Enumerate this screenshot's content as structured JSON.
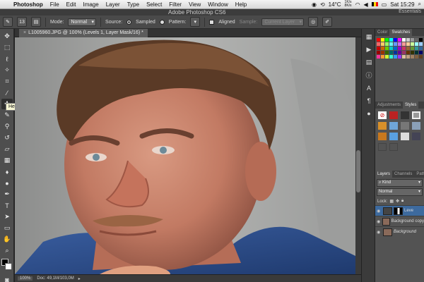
{
  "menubar": {
    "apple_icon": "apple-icon",
    "app": "Photoshop",
    "items": [
      "File",
      "Edit",
      "Image",
      "Layer",
      "Type",
      "Select",
      "Filter",
      "View",
      "Window",
      "Help"
    ],
    "temp": "14°C",
    "net_top": "1K/s",
    "net_bottom": "8K/s",
    "time": "Sat 15:29"
  },
  "titlebar": {
    "title": "Adobe Photoshop CS6",
    "workspace": "Essentials"
  },
  "options": {
    "brush_size": "13",
    "mode_label": "Mode:",
    "mode_value": "Normal",
    "source_label": "Source:",
    "sampled": "Sampled",
    "pattern": "Pattern:",
    "aligned": "Aligned",
    "sample_label": "Sample:",
    "sample_value": "Current Layer"
  },
  "tooltip": "Healing Brush Tool (J)",
  "document": {
    "tab_close": "×",
    "tab_title": "L1005960.JPG @ 100% (Levels 1, Layer Mask/16) *"
  },
  "status": {
    "zoom": "100%",
    "doc": "Doc: 49,1M/103,0M"
  },
  "panels": {
    "color_tab": "Color",
    "swatches_tab": "Swatches",
    "adjustments_tab": "Adjustments",
    "styles_tab": "Styles",
    "layers_tab": "Layers",
    "channels_tab": "Channels",
    "paths_tab": "Paths",
    "kind_label": "Kind",
    "blend_mode": "Normal",
    "lock_label": "Lock:",
    "layers": [
      {
        "name": "Leve",
        "selected": true
      },
      {
        "name": "Background copy",
        "selected": false
      },
      {
        "name": "Background",
        "selected": false
      }
    ],
    "swatch_colors": [
      "#ff0000",
      "#ffff00",
      "#00ff00",
      "#00ffff",
      "#0000ff",
      "#ff00ff",
      "#ffffff",
      "#cccccc",
      "#999999",
      "#666666",
      "#000000",
      "#ff6666",
      "#ffcc66",
      "#99ff66",
      "#66ffff",
      "#6699ff",
      "#cc66ff",
      "#ff9999",
      "#ffcc99",
      "#ccff99",
      "#99ffff",
      "#99ccff",
      "#cc0000",
      "#cc6600",
      "#66cc00",
      "#00cccc",
      "#0066cc",
      "#9900cc",
      "#cc3366",
      "#996633",
      "#669933",
      "#339999",
      "#336699",
      "#990000",
      "#993300",
      "#336600",
      "#006666",
      "#003399",
      "#660099",
      "#993366",
      "#663300",
      "#333300",
      "#003333",
      "#000066",
      "#ff3399",
      "#ff9933",
      "#ccff33",
      "#33ffcc",
      "#3399ff",
      "#9933ff",
      "#e0c0a0",
      "#c0a080",
      "#a08060",
      "#806040",
      "#604020"
    ]
  }
}
